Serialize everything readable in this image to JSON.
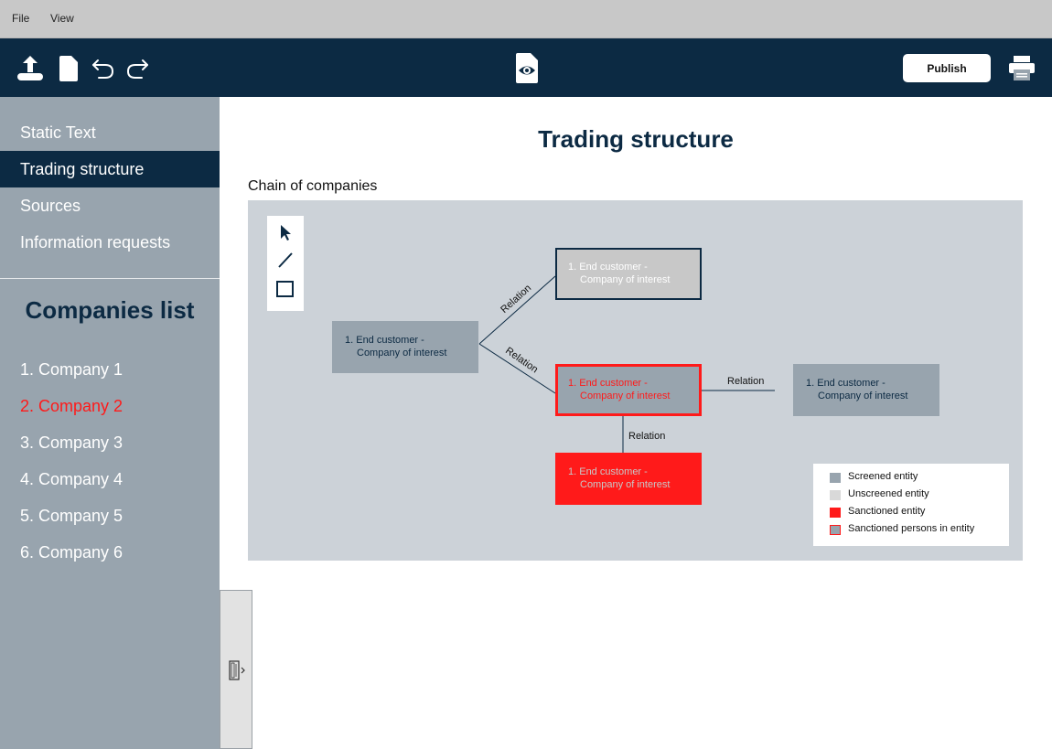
{
  "menu": {
    "file": "File",
    "view": "View"
  },
  "toolbar": {
    "icons": [
      "upload-icon",
      "new-document-icon",
      "undo-icon",
      "redo-icon",
      "preview-icon",
      "print-icon"
    ],
    "publish_label": "Publish"
  },
  "sidebar": {
    "nav": [
      {
        "label": "Static Text",
        "active": false
      },
      {
        "label": "Trading structure",
        "active": true
      },
      {
        "label": "Sources",
        "active": false
      },
      {
        "label": "Information requests",
        "active": false
      }
    ],
    "companies_title": "Companies list",
    "companies": [
      {
        "label": "1. Company 1",
        "selected": false
      },
      {
        "label": "2. Company 2",
        "selected": true
      },
      {
        "label": "3. Company 3",
        "selected": false
      },
      {
        "label": "4. Company 4",
        "selected": false
      },
      {
        "label": "5. Company 5",
        "selected": false
      },
      {
        "label": "6. Company 6",
        "selected": false
      }
    ]
  },
  "main": {
    "title": "Trading structure",
    "section_label": "Chain of companies"
  },
  "diagram": {
    "tools": [
      "pointer-tool-icon",
      "line-tool-icon",
      "rectangle-tool-icon"
    ],
    "nodes": [
      {
        "line1": "1. End customer -",
        "line2": "Company of interest",
        "status": "screened"
      },
      {
        "line1": "1. End customer -",
        "line2": "Company of interest",
        "status": "unscreened"
      },
      {
        "line1": "1. End customer -",
        "line2": "Company of interest",
        "status": "sanctioned-persons"
      },
      {
        "line1": "1. End customer -",
        "line2": "Company of interest",
        "status": "screened"
      },
      {
        "line1": "1. End customer -",
        "line2": "Company of interest",
        "status": "sanctioned"
      }
    ],
    "relations": [
      "Relation",
      "Relation",
      "Relation",
      "Relation"
    ],
    "legend": [
      {
        "label": "Screened entity",
        "color": "#98a4ae"
      },
      {
        "label": "Unscreened entity",
        "color": "#d9d9d9"
      },
      {
        "label": "Sanctioned entity",
        "color": "#ff1a1a"
      },
      {
        "label": "Sanctioned persons in entity",
        "color": "#98a4ae",
        "border": "#ff1a1a"
      }
    ]
  },
  "colors": {
    "navy": "#0c2a43",
    "sidebar": "#98a4ae",
    "canvas": "#ccd2d8",
    "sanction_red": "#ff1a1a"
  }
}
